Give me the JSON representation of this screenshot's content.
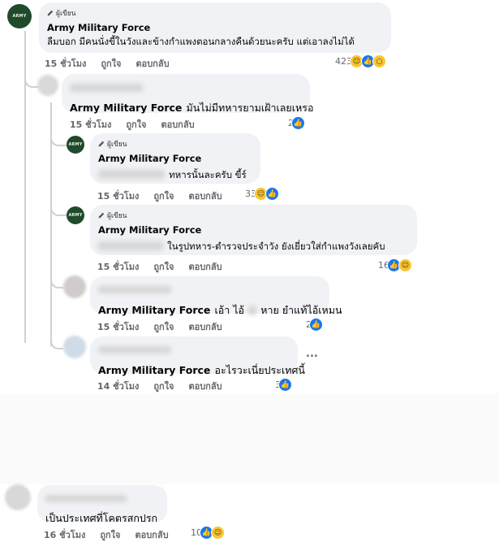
{
  "author_badge": "ผู้เขียน",
  "army_avatar_text": "ARMY",
  "comments": [
    {
      "name": "Army Military Force",
      "text": "ลืมบอก มีคนนั่งขี้ในวังและข้างกำแพงตอนกลางคืนด้วยนะครับ แต่เอาลงไม่ได้",
      "time": "15 ชั่วโมง",
      "like": "ถูกใจ",
      "reply": "ตอบกลับ",
      "reaction_count": "423"
    },
    {
      "name": "Army Military Force",
      "text": "มันไม่มีทหารยามเฝ้าเลยเหรอ",
      "time": "15 ชั่วโมง",
      "like": "ถูกใจ",
      "reply": "ตอบกลับ",
      "reaction_count": "2"
    },
    {
      "name": "Army Military Force",
      "text": "ทหารนั้นละครับ ขี้ร์",
      "time": "15 ชั่วโมง",
      "like": "ถูกใจ",
      "reply": "ตอบกลับ",
      "reaction_count": "33"
    },
    {
      "name": "Army Military Force",
      "text": "ในรูปทหาร-ตำรวจประจำวัง ยังเยี่ยวใส่กำแพงวังเลยคับ",
      "time": "15 ชั่วโมง",
      "like": "ถูกใจ",
      "reply": "ตอบกลับ",
      "reaction_count": "16"
    },
    {
      "name": "Army Military Force",
      "text_a": "เอ้า ไอ้",
      "text_b": "หาย ยำแท้ไอ้เหมน",
      "time": "15 ชั่วโมง",
      "like": "ถูกใจ",
      "reply": "ตอบกลับ",
      "reaction_count": "2"
    },
    {
      "name": "Army Military Force",
      "text": "อะไรวะเนี่ยประเทศนี้",
      "time": "14 ชั่วโมง",
      "like": "ถูกใจ",
      "reply": "ตอบกลับ",
      "reaction_count": "3",
      "more": "..."
    },
    {
      "text": "เป็นประเทศที่โคตรสกปรก",
      "time": "16 ชั่วโมง",
      "like": "ถูกใจ",
      "reply": "ตอบกลับ",
      "reaction_count": "10"
    }
  ],
  "icons": {
    "like": "like-icon",
    "haha": "haha-icon",
    "wow": "wow-icon",
    "pencil": "pencil-icon"
  },
  "colors": {
    "bubble": "#f0f2f5",
    "meta": "#65676b",
    "like_blue": "#1877f2",
    "army_green": "#1f4a2c"
  }
}
